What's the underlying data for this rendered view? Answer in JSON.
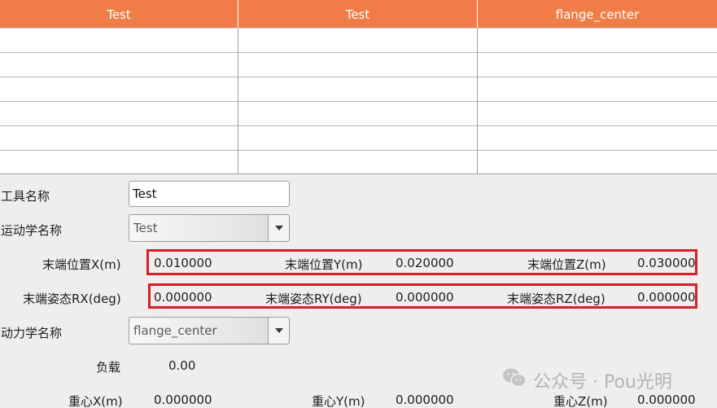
{
  "table": {
    "headers": [
      "Test",
      "Test",
      "flange_center"
    ],
    "rows": [
      [
        "",
        "",
        ""
      ],
      [
        "",
        "",
        ""
      ],
      [
        "",
        "",
        ""
      ],
      [
        "",
        "",
        ""
      ],
      [
        "",
        "",
        ""
      ],
      [
        "",
        "",
        ""
      ]
    ]
  },
  "form": {
    "tool_name_label": "工具名称",
    "tool_name_value": "Test",
    "kinematics_label": "运动学名称",
    "kinematics_value": "Test",
    "pos_x_label": "末端位置X(m)",
    "pos_x_value": "0.010000",
    "pos_y_label": "末端位置Y(m)",
    "pos_y_value": "0.020000",
    "pos_z_label": "末端位置Z(m)",
    "pos_z_value": "0.030000",
    "rot_x_label": "末端姿态RX(deg)",
    "rot_x_value": "0.000000",
    "rot_y_label": "末端姿态RY(deg)",
    "rot_y_value": "0.000000",
    "rot_z_label": "末端姿态RZ(deg)",
    "rot_z_value": "0.000000",
    "dynamics_label": "动力学名称",
    "dynamics_value": "flange_center",
    "load_label": "负载",
    "load_value": "0.00",
    "cog_x_label": "重心X(m)",
    "cog_x_value": "0.000000",
    "cog_y_label": "重心Y(m)",
    "cog_y_value": "0.000000",
    "cog_z_label": "重心Z(m)",
    "cog_z_value": "0.000000"
  },
  "watermark": {
    "text": "公众号 · Pou光明"
  },
  "colors": {
    "header_bg": "#f07d47",
    "highlight_box": "#d6202a",
    "panel_bg": "#efeeec"
  }
}
